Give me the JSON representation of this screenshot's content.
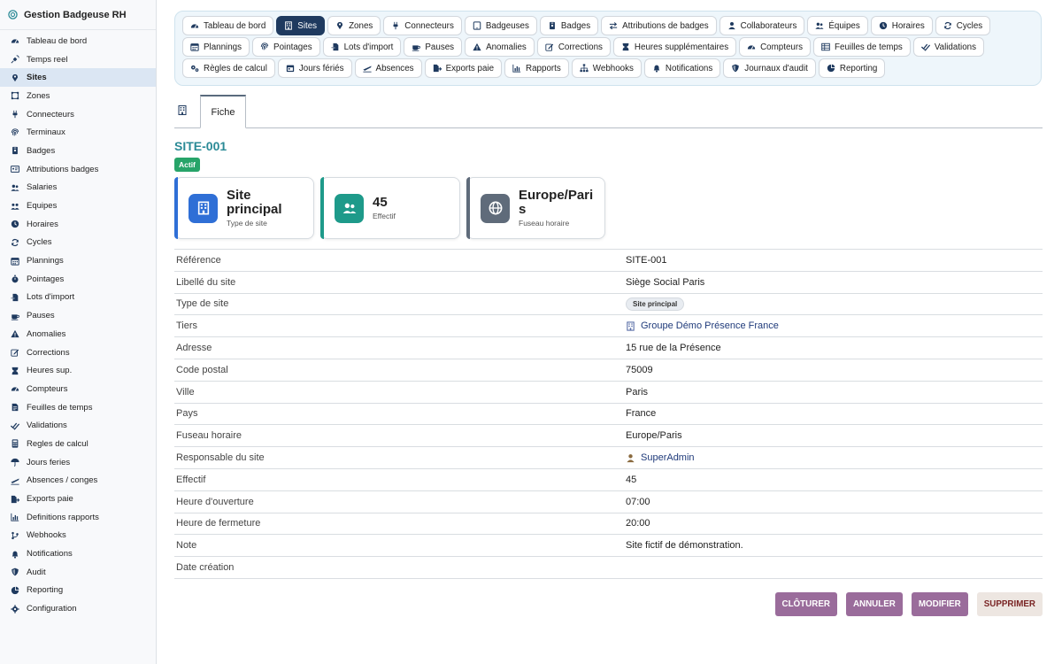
{
  "sidebar": {
    "title": "Gestion Badgeuse RH",
    "items": [
      {
        "label": "Tableau de bord",
        "icon": "dashboard-icon"
      },
      {
        "label": "Temps reel",
        "icon": "satellite-icon"
      },
      {
        "label": "Sites",
        "icon": "map-pin-icon",
        "active": true
      },
      {
        "label": "Zones",
        "icon": "zone-icon"
      },
      {
        "label": "Connecteurs",
        "icon": "plug-icon"
      },
      {
        "label": "Terminaux",
        "icon": "fingerprint-icon"
      },
      {
        "label": "Badges",
        "icon": "badge-icon"
      },
      {
        "label": "Attributions badges",
        "icon": "id-card-icon"
      },
      {
        "label": "Salaries",
        "icon": "users-icon"
      },
      {
        "label": "Equipes",
        "icon": "team-icon"
      },
      {
        "label": "Horaires",
        "icon": "clock-icon"
      },
      {
        "label": "Cycles",
        "icon": "sync-icon"
      },
      {
        "label": "Plannings",
        "icon": "calendar-icon"
      },
      {
        "label": "Pointages",
        "icon": "stopwatch-icon"
      },
      {
        "label": "Lots d'import",
        "icon": "file-import-icon"
      },
      {
        "label": "Pauses",
        "icon": "coffee-icon"
      },
      {
        "label": "Anomalies",
        "icon": "warning-icon"
      },
      {
        "label": "Corrections",
        "icon": "edit-icon"
      },
      {
        "label": "Heures sup.",
        "icon": "hourglass-icon"
      },
      {
        "label": "Compteurs",
        "icon": "gauge-icon"
      },
      {
        "label": "Feuilles de temps",
        "icon": "timesheet-icon"
      },
      {
        "label": "Validations",
        "icon": "check-double-icon"
      },
      {
        "label": "Regles de calcul",
        "icon": "calculator-icon"
      },
      {
        "label": "Jours feries",
        "icon": "umbrella-icon"
      },
      {
        "label": "Absences / conges",
        "icon": "plane-icon"
      },
      {
        "label": "Exports paie",
        "icon": "file-export-icon"
      },
      {
        "label": "Definitions rapports",
        "icon": "chart-icon"
      },
      {
        "label": "Webhooks",
        "icon": "branch-icon"
      },
      {
        "label": "Notifications",
        "icon": "bell-icon"
      },
      {
        "label": "Audit",
        "icon": "shield-icon"
      },
      {
        "label": "Reporting",
        "icon": "pie-icon"
      },
      {
        "label": "Configuration",
        "icon": "gear-icon"
      }
    ]
  },
  "topnav": [
    {
      "label": "Tableau de bord",
      "icon": "dashboard-icon"
    },
    {
      "label": "Sites",
      "icon": "building-icon",
      "active": true
    },
    {
      "label": "Zones",
      "icon": "map-pin-icon"
    },
    {
      "label": "Connecteurs",
      "icon": "plug-icon"
    },
    {
      "label": "Badgeuses",
      "icon": "tablet-icon"
    },
    {
      "label": "Badges",
      "icon": "badge-icon"
    },
    {
      "label": "Attributions de badges",
      "icon": "exchange-icon"
    },
    {
      "label": "Collaborateurs",
      "icon": "user-icon"
    },
    {
      "label": "Équipes",
      "icon": "users-icon"
    },
    {
      "label": "Horaires",
      "icon": "clock-icon"
    },
    {
      "label": "Cycles",
      "icon": "sync-icon"
    },
    {
      "label": "Plannings",
      "icon": "calendar-icon"
    },
    {
      "label": "Pointages",
      "icon": "fingerprint-icon"
    },
    {
      "label": "Lots d'import",
      "icon": "file-import-icon"
    },
    {
      "label": "Pauses",
      "icon": "coffee-icon"
    },
    {
      "label": "Anomalies",
      "icon": "warning-icon"
    },
    {
      "label": "Corrections",
      "icon": "edit-icon"
    },
    {
      "label": "Heures supplémentaires",
      "icon": "hourglass-icon"
    },
    {
      "label": "Compteurs",
      "icon": "gauge-icon"
    },
    {
      "label": "Feuilles de temps",
      "icon": "table-icon"
    },
    {
      "label": "Validations",
      "icon": "check-double-icon"
    },
    {
      "label": "Règles de calcul",
      "icon": "gears-icon"
    },
    {
      "label": "Jours fériés",
      "icon": "calendar-day-icon"
    },
    {
      "label": "Absences",
      "icon": "plane-icon"
    },
    {
      "label": "Exports paie",
      "icon": "file-export-icon"
    },
    {
      "label": "Rapports",
      "icon": "chart-icon"
    },
    {
      "label": "Webhooks",
      "icon": "sitemap-icon"
    },
    {
      "label": "Notifications",
      "icon": "bell-icon"
    },
    {
      "label": "Journaux d'audit",
      "icon": "shield-icon"
    },
    {
      "label": "Reporting",
      "icon": "pie-icon"
    }
  ],
  "tabs": {
    "fiche": "Fiche"
  },
  "record": {
    "ref": "SITE-001",
    "status": "Actif"
  },
  "cards": [
    {
      "value": "Site principal",
      "label": "Type de site",
      "color": "#2f6fd6",
      "icon": "building-icon"
    },
    {
      "value": "45",
      "label": "Effectif",
      "color": "#1e9a8a",
      "icon": "users-icon"
    },
    {
      "value": "Europe/Paris",
      "label": "Fuseau horaire",
      "color": "#5f6b7a",
      "icon": "globe-icon"
    }
  ],
  "details": [
    {
      "key": "Référence",
      "value": "SITE-001"
    },
    {
      "key": "Libellé du site",
      "value": "Siège Social Paris"
    },
    {
      "key": "Type de site",
      "value": "Site principal",
      "chip": true
    },
    {
      "key": "Tiers",
      "value": "Groupe Démo Présence France",
      "link": true,
      "icon": "building-icon"
    },
    {
      "key": "Adresse",
      "value": "15 rue de la Présence"
    },
    {
      "key": "Code postal",
      "value": "75009"
    },
    {
      "key": "Ville",
      "value": "Paris"
    },
    {
      "key": "Pays",
      "value": "France"
    },
    {
      "key": "Fuseau horaire",
      "value": "Europe/Paris"
    },
    {
      "key": "Responsable du site",
      "value": "SuperAdmin",
      "link": true,
      "icon": "user-icon"
    },
    {
      "key": "Effectif",
      "value": "45"
    },
    {
      "key": "Heure d'ouverture",
      "value": "07:00"
    },
    {
      "key": "Heure de fermeture",
      "value": "20:00"
    },
    {
      "key": "Note",
      "value": "Site fictif de démonstration."
    },
    {
      "key": "Date création",
      "value": ""
    }
  ],
  "actions": {
    "cloturer": "CLÔTURER",
    "annuler": "ANNULER",
    "modifier": "MODIFIER",
    "supprimer": "SUPPRIMER"
  },
  "colors": {
    "active_nav": "#1f3a5f",
    "title_teal": "#2a8a96",
    "status_green": "#27a469",
    "button_primary": "#9a6c9b",
    "button_danger_bg": "#ede6e1",
    "link": "#1f3a7a"
  }
}
